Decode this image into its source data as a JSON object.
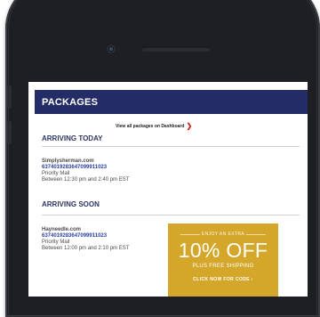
{
  "header": {
    "title": "PACKAGES"
  },
  "dashboard_link": {
    "label": "View all packages on Dashboard",
    "arrow": "❯"
  },
  "sections": {
    "today": {
      "title": "ARRIVING TODAY"
    },
    "soon": {
      "title": "ARRIVING SOON"
    }
  },
  "packages": [
    {
      "store": "Simplysherman.com",
      "tracking": "6374019283647099911023",
      "service": "Priority Mail",
      "window": "Between 12:30 pm and 2:40 pm EST"
    },
    {
      "store": "Hayneedle.com",
      "tracking": "6374019283647099911023",
      "service": "Priority Mail",
      "window": "Between 12:00 pm and 2:10 pm EST"
    }
  ],
  "promo": {
    "top": "ENJOY AN EXTRA",
    "headline": "10% OFF",
    "shipping": "PLUS FREE SHIPPING",
    "cta": "CLICK NOW FOR CODE ›",
    "color": "#d4a72a"
  },
  "colors": {
    "header": "#232c66",
    "accent": "#d22020",
    "link": "#2b3fa5"
  }
}
